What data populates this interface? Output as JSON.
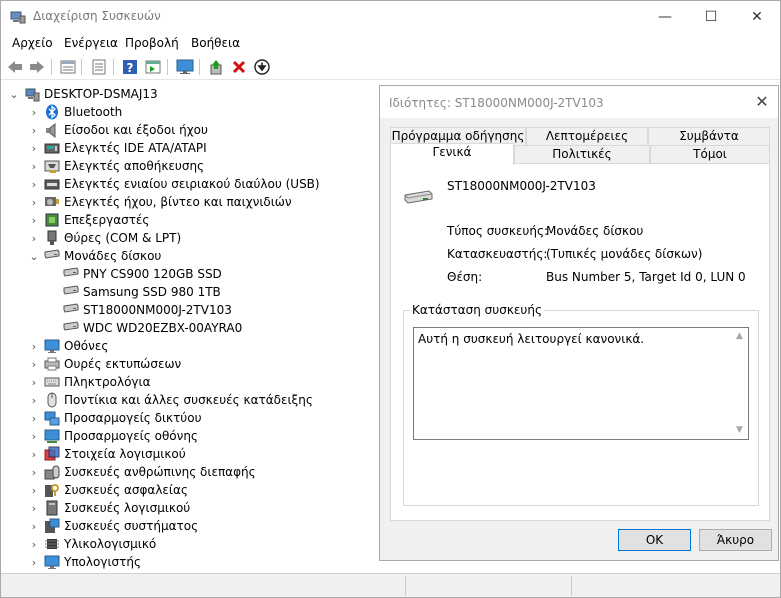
{
  "window": {
    "title": "Διαχείριση Συσκευών",
    "min": "—",
    "max": "☐",
    "close": "✕"
  },
  "menu": [
    "Αρχείο",
    "Ενέργεια",
    "Προβολή",
    "Βοήθεια"
  ],
  "toolbar": {
    "buttons": [
      "back-icon",
      "forward-icon",
      "properties-view-icon",
      "list-icon",
      "help-icon",
      "run-icon",
      "monitor-icon",
      "update-driver-icon",
      "uninstall-icon",
      "download-icon"
    ]
  },
  "tree": {
    "root": "DESKTOP-DSMAJ13",
    "items": [
      {
        "label": "Bluetooth",
        "icon": "bluetooth-icon"
      },
      {
        "label": "Είσοδοι και έξοδοι ήχου",
        "icon": "speaker-icon"
      },
      {
        "label": "Ελεγκτές IDE ATA/ATAPI",
        "icon": "ide-controller-icon"
      },
      {
        "label": "Ελεγκτές αποθήκευσης",
        "icon": "storage-controller-icon"
      },
      {
        "label": "Ελεγκτές ενιαίου σειριακού διαύλου (USB)",
        "icon": "usb-icon"
      },
      {
        "label": "Ελεγκτές ήχου, βίντεο και παιχνιδιών",
        "icon": "sound-video-icon"
      },
      {
        "label": "Επεξεργαστές",
        "icon": "processor-icon"
      },
      {
        "label": "Θύρες (COM & LPT)",
        "icon": "port-icon"
      },
      {
        "label": "Μονάδες δίσκου",
        "icon": "disk-drive-icon",
        "expanded": true,
        "children": [
          "PNY CS900 120GB SSD",
          "Samsung SSD 980 1TB",
          "ST18000NM000J-2TV103",
          "WDC WD20EZBX-00AYRA0"
        ]
      },
      {
        "label": "Οθόνες",
        "icon": "monitor-icon"
      },
      {
        "label": "Ουρές εκτυπώσεων",
        "icon": "printer-queue-icon"
      },
      {
        "label": "Πληκτρολόγια",
        "icon": "keyboard-icon"
      },
      {
        "label": "Ποντίκια και άλλες συσκευές κατάδειξης",
        "icon": "mouse-icon"
      },
      {
        "label": "Προσαρμογείς δικτύου",
        "icon": "network-adapter-icon"
      },
      {
        "label": "Προσαρμογείς οθόνης",
        "icon": "display-adapter-icon"
      },
      {
        "label": "Στοιχεία λογισμικού",
        "icon": "software-component-icon"
      },
      {
        "label": "Συσκευές ανθρώπινης διεπαφής",
        "icon": "hid-icon"
      },
      {
        "label": "Συσκευές ασφαλείας",
        "icon": "security-device-icon"
      },
      {
        "label": "Συσκευές λογισμικού",
        "icon": "software-device-icon"
      },
      {
        "label": "Συσκευές συστήματος",
        "icon": "system-device-icon"
      },
      {
        "label": "Υλικολογισμικό",
        "icon": "firmware-icon"
      },
      {
        "label": "Υπολογιστής",
        "icon": "computer-icon"
      }
    ]
  },
  "dialog": {
    "title": "Ιδιότητες: ST18000NM000J-2TV103",
    "close": "✕",
    "tabs_top": [
      "Πρόγραμμα οδήγησης",
      "Λεπτομέρειες",
      "Συμβάντα"
    ],
    "tabs_bottom": [
      "Γενικά",
      "Πολιτικές",
      "Τόμοι"
    ],
    "active_tab": "Γενικά",
    "device_name": "ST18000NM000J-2TV103",
    "props": [
      {
        "label": "Τύπος συσκευής:",
        "value": "Μονάδες δίσκου"
      },
      {
        "label": "Κατασκευαστής:",
        "value": "(Τυπικές μονάδες δίσκων)"
      },
      {
        "label": "Θέση:",
        "value": "Bus Number 5, Target Id 0, LUN 0"
      }
    ],
    "status_group_label": "Κατάσταση συσκευής",
    "status_text": "Αυτή η συσκευή λειτουργεί κανονικά.",
    "ok": "OK",
    "cancel": "Άκυρο"
  },
  "colors": {
    "accent": "#0078d7",
    "help_icon": "#2f5fb3",
    "uninstall": "#d01010",
    "update_green": "#1e9e1e"
  }
}
